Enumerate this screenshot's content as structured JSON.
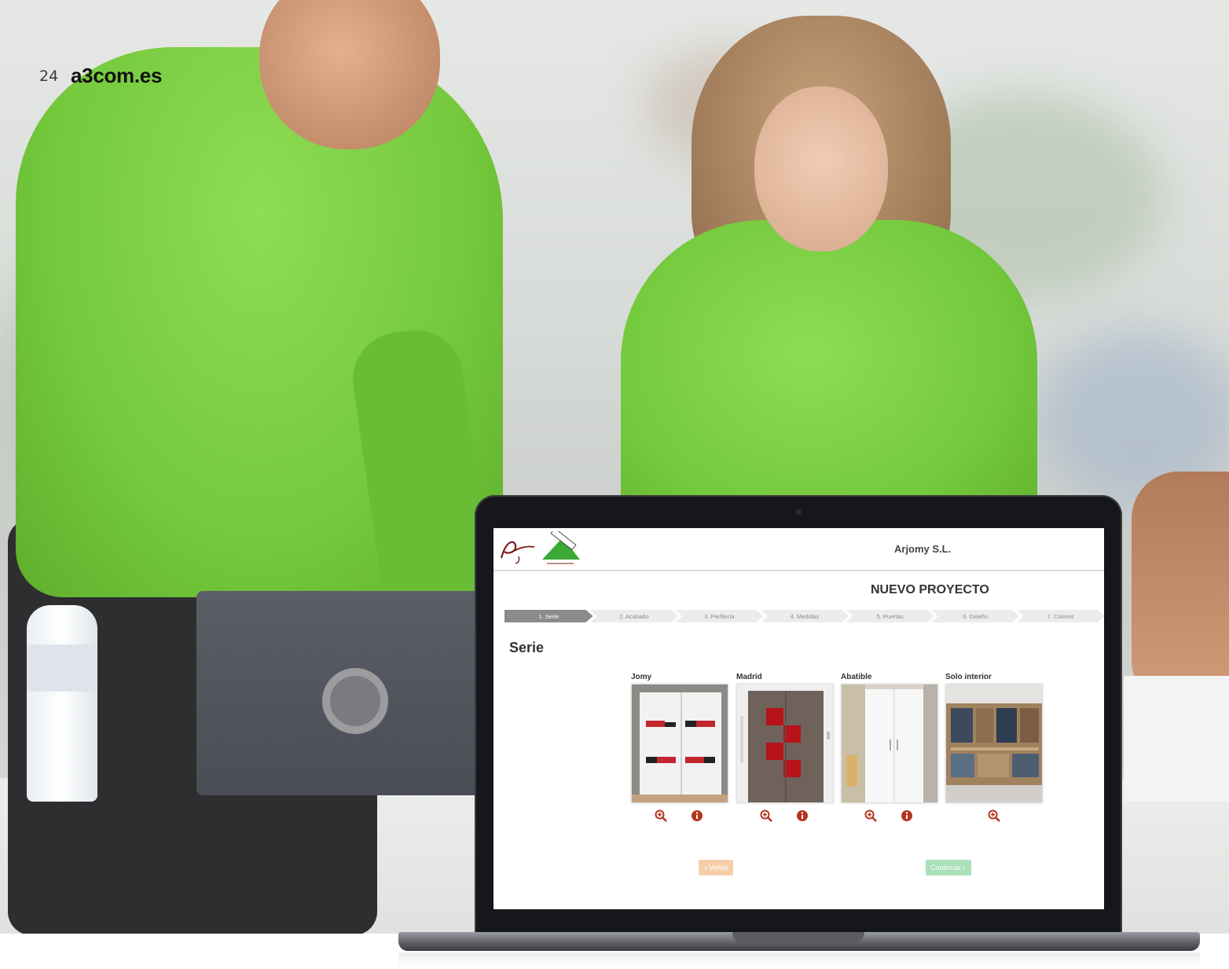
{
  "page": {
    "number": "24",
    "site": "a3com.es"
  },
  "app": {
    "company": "Arjomy S.L.",
    "title": "NUEVO PROYECTO",
    "logos": [
      "arjomy-logo",
      "leroy-merlin-logo"
    ],
    "steps": [
      {
        "label": "1. Serie",
        "active": true
      },
      {
        "label": "2. Acabado",
        "active": false
      },
      {
        "label": "3. Perfilería",
        "active": false
      },
      {
        "label": "4. Medidas",
        "active": false
      },
      {
        "label": "5. Puertas",
        "active": false
      },
      {
        "label": "6. Diseño",
        "active": false
      },
      {
        "label": "7. Colores",
        "active": false
      }
    ],
    "section_title": "Serie",
    "cards": [
      {
        "label": "Jomy",
        "icons": [
          "zoom-in-icon",
          "info-icon"
        ]
      },
      {
        "label": "Madrid",
        "icons": [
          "zoom-in-icon",
          "info-icon"
        ]
      },
      {
        "label": "Abatible",
        "icons": [
          "zoom-in-icon",
          "info-icon"
        ]
      },
      {
        "label": "Solo interior",
        "icons": [
          "zoom-in-icon"
        ]
      }
    ],
    "buttons": {
      "back": "Volver",
      "next": "Continuar"
    },
    "colors": {
      "icon_red": "#b5361f",
      "back_button": "#f6cfa8",
      "next_button": "#a9e0b9",
      "active_step": "#8b8b8b"
    }
  }
}
